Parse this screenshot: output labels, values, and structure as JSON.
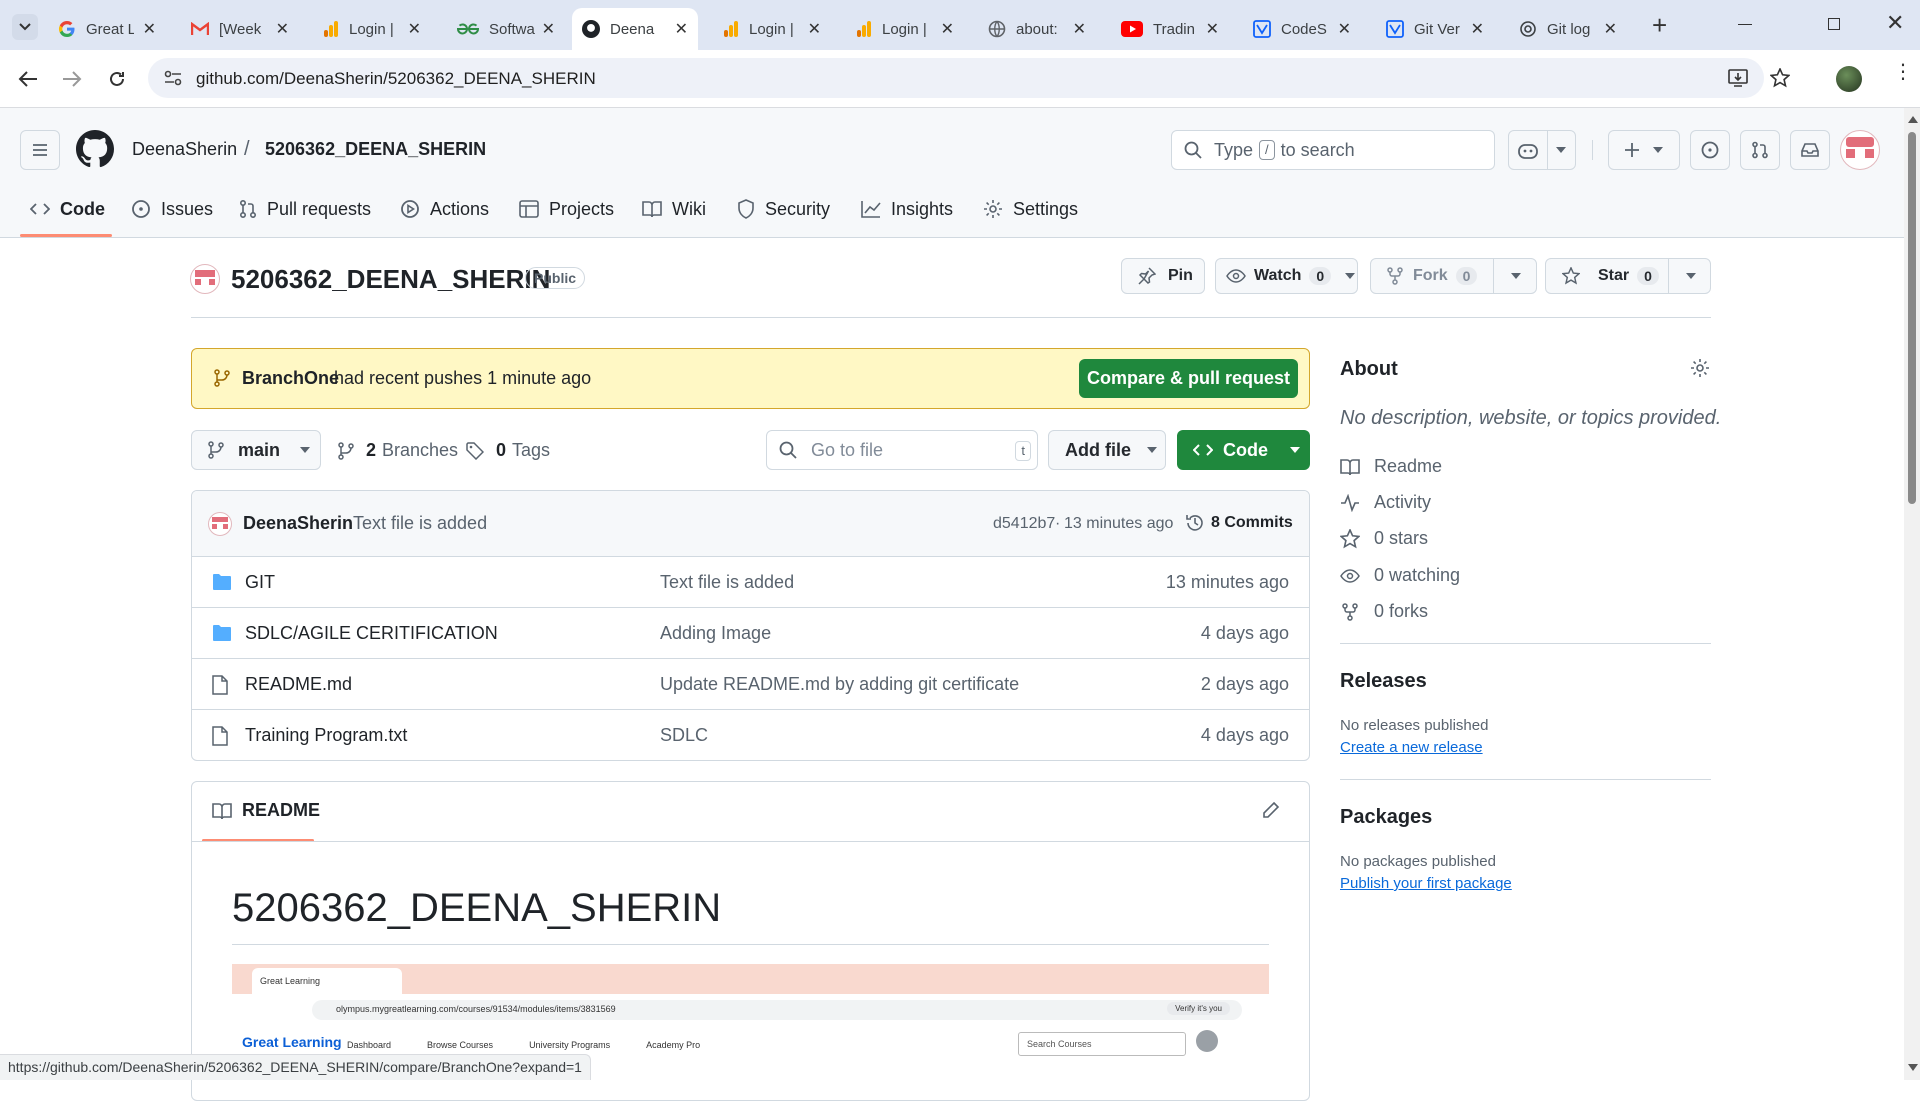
{
  "browser": {
    "tabs": [
      {
        "title": "Great L",
        "icon": "google-icon"
      },
      {
        "title": "[Week",
        "icon": "gmail-icon"
      },
      {
        "title": "Login |",
        "icon": "analytics-icon"
      },
      {
        "title": "Softwa",
        "icon": "gfg-icon"
      },
      {
        "title": "Deena",
        "icon": "github-icon",
        "active": true
      },
      {
        "title": "Login |",
        "icon": "analytics-icon"
      },
      {
        "title": "Login |",
        "icon": "analytics-icon"
      },
      {
        "title": "about:",
        "icon": "globe-icon"
      },
      {
        "title": "Tradin",
        "icon": "youtube-icon"
      },
      {
        "title": "CodeS",
        "icon": "codesignal-icon"
      },
      {
        "title": "Git Ver",
        "icon": "codesignal-icon"
      },
      {
        "title": "Git log",
        "icon": "chatgpt-icon"
      }
    ],
    "url": "github.com/DeenaSherin/5206362_DEENA_SHERIN",
    "status_url": "https://github.com/DeenaSherin/5206362_DEENA_SHERIN/compare/BranchOne?expand=1"
  },
  "header": {
    "owner": "DeenaSherin",
    "separator": "/",
    "repo": "5206362_DEENA_SHERIN",
    "search_prefix": "Type",
    "search_key": "/",
    "search_suffix": "to search"
  },
  "nav": {
    "tabs": [
      "Code",
      "Issues",
      "Pull requests",
      "Actions",
      "Projects",
      "Wiki",
      "Security",
      "Insights",
      "Settings"
    ]
  },
  "repo": {
    "name": "5206362_DEENA_SHERIN",
    "visibility": "Public",
    "pin_label": "Pin",
    "watch_label": "Watch",
    "watch_count": "0",
    "fork_label": "Fork",
    "fork_count": "0",
    "star_label": "Star",
    "star_count": "0"
  },
  "banner": {
    "branch": "BranchOne",
    "text": "had recent pushes 1 minute ago",
    "button": "Compare & pull request"
  },
  "toolbar": {
    "branch": "main",
    "branches_count": "2",
    "branches_label": "Branches",
    "tags_count": "0",
    "tags_label": "Tags",
    "goto_placeholder": "Go to file",
    "goto_key": "t",
    "add_file": "Add file",
    "code": "Code"
  },
  "commit": {
    "author": "DeenaSherin",
    "message": "Text file is added",
    "hash": "d5412b7",
    "dot": "·",
    "age": "13 minutes ago",
    "commits": "8 Commits"
  },
  "files": [
    {
      "type": "folder",
      "name": "GIT",
      "message": "Text file is added",
      "age": "13 minutes ago"
    },
    {
      "type": "folder",
      "name": "SDLC/AGILE CERITIFICATION",
      "message": "Adding Image",
      "age": "4 days ago"
    },
    {
      "type": "file",
      "name": "README.md",
      "message": "Update README.md by adding git certificate",
      "age": "2 days ago"
    },
    {
      "type": "file",
      "name": "Training Program.txt",
      "message": "SDLC",
      "age": "4 days ago"
    }
  ],
  "readme": {
    "tab": "README",
    "heading": "5206362_DEENA_SHERIN",
    "screenshot": {
      "tab": "Great Learning",
      "url": "olympus.mygreatlearning.com/courses/91534/modules/items/3831569",
      "verify": "Verify it's you",
      "logo": "Great Learning",
      "nav": [
        "Dashboard",
        "Browse Courses",
        "University Programs",
        "Academy Pro"
      ],
      "search": "Search Courses"
    }
  },
  "about": {
    "title": "About",
    "description": "No description, website, or topics provided.",
    "items": [
      "Readme",
      "Activity",
      "0 stars",
      "0 watching",
      "0 forks"
    ],
    "releases_title": "Releases",
    "releases_text": "No releases published",
    "releases_link": "Create a new release",
    "packages_title": "Packages",
    "packages_text": "No packages published",
    "packages_link": "Publish your first package"
  },
  "colors": {
    "accent_green": "#1f883d",
    "link_blue": "#0969da",
    "banner_bg": "#fff8c5",
    "active_tab_underline": "#fd8c73"
  }
}
